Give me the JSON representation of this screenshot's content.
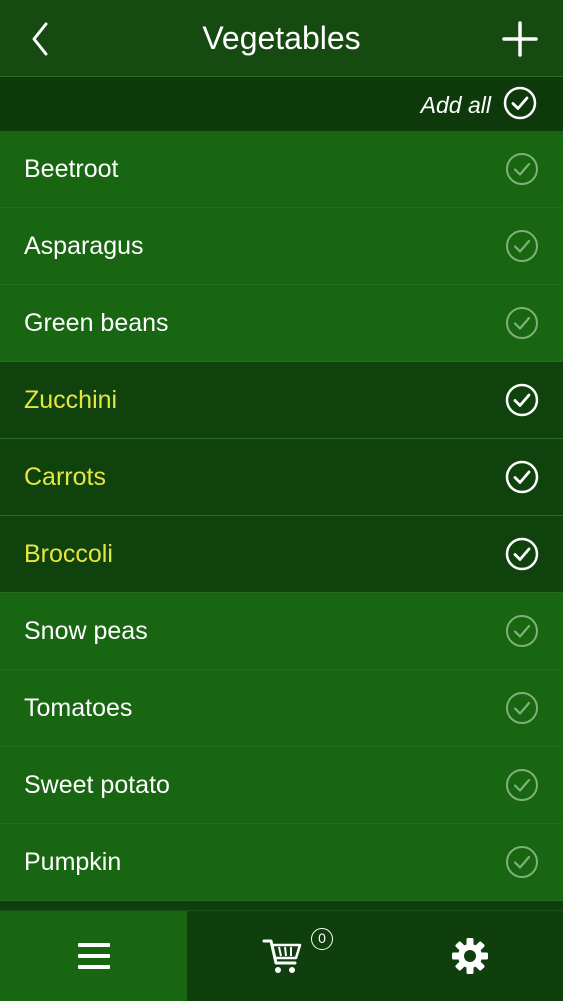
{
  "header": {
    "title": "Vegetables",
    "back_icon": "chevron-left-icon",
    "add_icon": "plus-icon"
  },
  "add_all": {
    "label": "Add all",
    "icon": "check-circle-icon"
  },
  "items": [
    {
      "label": "Beetroot",
      "selected": false
    },
    {
      "label": "Asparagus",
      "selected": false
    },
    {
      "label": "Green beans",
      "selected": false
    },
    {
      "label": "Zucchini",
      "selected": true
    },
    {
      "label": "Carrots",
      "selected": true
    },
    {
      "label": "Broccoli",
      "selected": true
    },
    {
      "label": "Snow peas",
      "selected": false
    },
    {
      "label": "Tomatoes",
      "selected": false
    },
    {
      "label": "Sweet potato",
      "selected": false
    },
    {
      "label": "Pumpkin",
      "selected": false
    }
  ],
  "tabbar": {
    "tabs": [
      {
        "name": "list",
        "icon": "hamburger-menu-icon",
        "active": true
      },
      {
        "name": "cart",
        "icon": "shopping-cart-icon",
        "active": false
      },
      {
        "name": "settings",
        "icon": "gear-icon",
        "active": false
      }
    ],
    "cart_count": "0"
  },
  "colors": {
    "row_background": "#186512",
    "selected_row_background": "#0f420c",
    "selected_text": "#e6e640",
    "header_background": "#154a10"
  }
}
